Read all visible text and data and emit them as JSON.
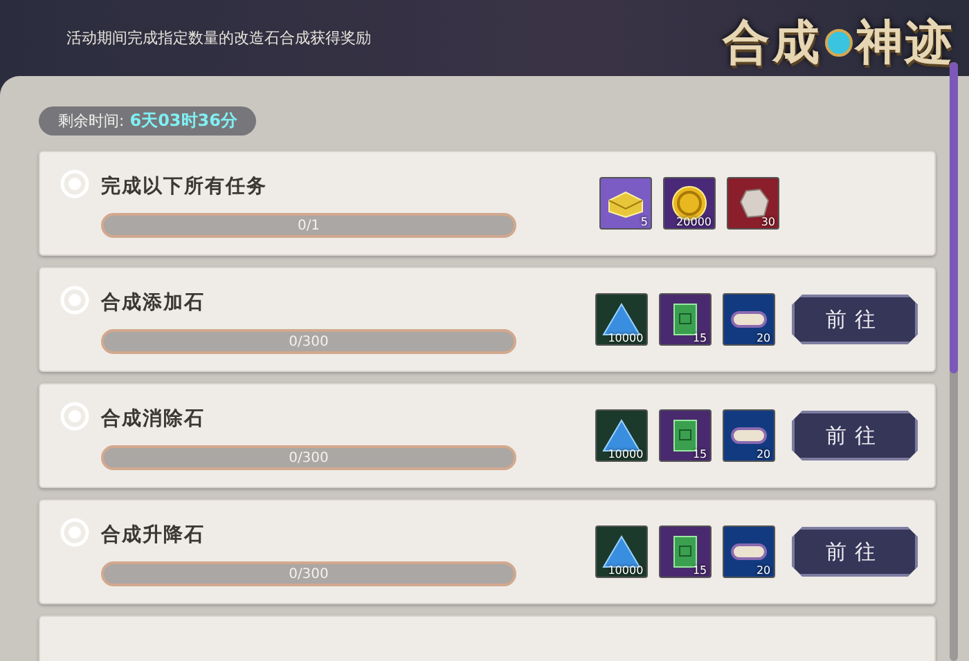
{
  "header": {
    "description": "活动期间完成指定数量的改造石合成获得奖励",
    "title_left": "合成",
    "title_right": "神迹"
  },
  "timer": {
    "label": "剩余时间:",
    "value": "6天03时36分"
  },
  "tasks": [
    {
      "title": "完成以下所有任务",
      "level": 0,
      "progress": "0/1",
      "rewards": [
        {
          "kind": "chest",
          "count": "5",
          "color": "#7a5cc4"
        },
        {
          "kind": "coin",
          "count": "20000",
          "color": "#4a2a78"
        },
        {
          "kind": "ore",
          "count": "30",
          "color": "#8a1e2a"
        }
      ]
    },
    {
      "title": "合成添加石",
      "level": 0,
      "progress": "0/300",
      "button": "前往",
      "rewards": [
        {
          "kind": "crystal",
          "count": "10000",
          "color": "#1c3a2c"
        },
        {
          "kind": "scroll",
          "count": "15",
          "color": "#4a2a6e"
        },
        {
          "kind": "roll",
          "count": "20",
          "color": "#123a80"
        }
      ]
    },
    {
      "title": "合成消除石",
      "level": 0,
      "progress": "0/300",
      "button": "前往",
      "rewards": [
        {
          "kind": "crystal",
          "count": "10000",
          "color": "#1c3a2c"
        },
        {
          "kind": "scroll",
          "count": "15",
          "color": "#4a2a6e"
        },
        {
          "kind": "roll",
          "count": "20",
          "color": "#123a80"
        }
      ]
    },
    {
      "title": "合成升降石",
      "level": 0,
      "progress": "0/300",
      "button": "前往",
      "rewards": [
        {
          "kind": "crystal",
          "count": "10000",
          "color": "#1c3a2c"
        },
        {
          "kind": "scroll",
          "count": "15",
          "color": "#4a2a6e"
        },
        {
          "kind": "roll",
          "count": "20",
          "color": "#123a80"
        }
      ]
    }
  ]
}
